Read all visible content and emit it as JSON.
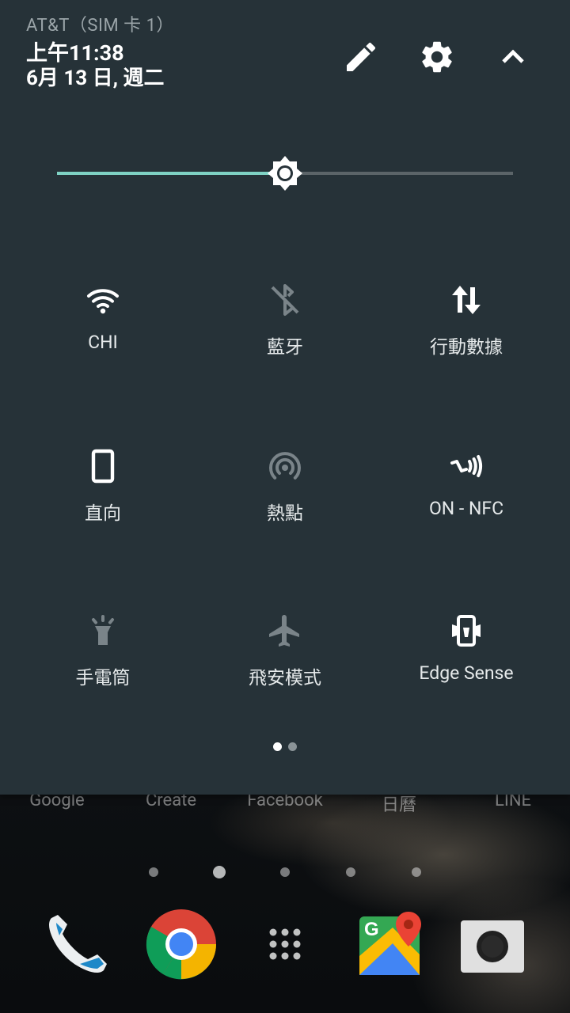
{
  "status": {
    "carrier": "AT&T（SIM 卡 1）",
    "time": "上午11:38",
    "date": "6月 13 日, 週二"
  },
  "header_icons": [
    "edit-icon",
    "settings-icon",
    "collapse-icon"
  ],
  "brightness": {
    "level": 0.5
  },
  "tiles": [
    {
      "label": "CHI",
      "icon": "wifi-icon",
      "active": true
    },
    {
      "label": "藍牙",
      "icon": "bluetooth-off-icon",
      "active": false
    },
    {
      "label": "行動數據",
      "icon": "mobile-data-icon",
      "active": true
    },
    {
      "label": "直向",
      "icon": "portrait-icon",
      "active": true
    },
    {
      "label": "熱點",
      "icon": "hotspot-icon",
      "active": false
    },
    {
      "label": "ON - NFC",
      "icon": "nfc-icon",
      "active": true
    },
    {
      "label": "手電筒",
      "icon": "flashlight-icon",
      "active": false
    },
    {
      "label": "飛安模式",
      "icon": "airplane-icon",
      "active": false
    },
    {
      "label": "Edge Sense",
      "icon": "edge-sense-icon",
      "active": true
    }
  ],
  "tile_pages": {
    "count": 2,
    "current": 1
  },
  "home": {
    "app_labels": [
      "Google",
      "Create",
      "Facebook",
      "日曆",
      "LINE"
    ],
    "page_count": 5,
    "current_page": 2,
    "dock": [
      "phone-icon",
      "chrome-icon",
      "app-drawer-icon",
      "maps-icon",
      "camera-icon"
    ]
  },
  "colors": {
    "shade_bg": "#263238",
    "accent": "#7fd2c4",
    "tile_active": "#ffffff",
    "tile_inactive": "#7a8489"
  }
}
